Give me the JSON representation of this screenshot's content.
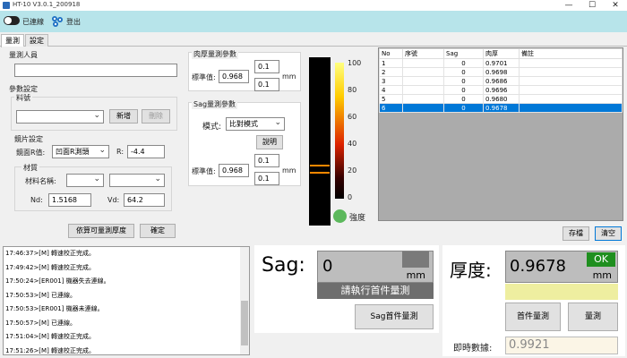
{
  "window": {
    "title": "HT-10 V3.0.1_200918",
    "minimize": "—",
    "maximize": "☐",
    "close": "✕"
  },
  "toolbar": {
    "connect_label": "已連線",
    "logout_label": "登出"
  },
  "tabs": [
    {
      "label": "量測"
    },
    {
      "label": "設定"
    }
  ],
  "left": {
    "operator_label": "量測人員",
    "operator_value": "",
    "params_label": "參數設定",
    "material_no_label": "料號",
    "material_no_value": "",
    "add_label": "新增",
    "delete_label": "刪除",
    "lens_label": "鏡片設定",
    "r_mode_label": "鏡面R值:",
    "r_mode_value": "凹面R測頭",
    "r_label": "R:",
    "r_value": "-4.4",
    "material_label": "材質",
    "material_name_label": "材料名稱:",
    "material_name_value": "",
    "material_name_value2": "",
    "nd_label": "Nd:",
    "nd_value": "1.5168",
    "vd_label": "Vd:",
    "vd_value": "64.2",
    "calc_label": "依算可量測厚度",
    "confirm_label": "確定"
  },
  "mid": {
    "thick_group_label": "肉厚量測參數",
    "std_label": "標準值:",
    "std_value": "0.968",
    "tol_plus": "0.1",
    "tol_minus": "0.1",
    "unit_mm": "mm",
    "sag_group_label": "Sag量測參數",
    "mode_label": "模式:",
    "mode_value": "比對模式",
    "explain_label": "說明",
    "sag_std_label": "標準值:",
    "sag_std_value": "0.968",
    "sag_tol_plus": "0.1",
    "sag_tol_minus": "0.1",
    "sag_unit": "mm"
  },
  "gauge": {
    "ticks": [
      "100",
      "80",
      "60",
      "40",
      "20",
      "0"
    ],
    "intensity_label": "強度",
    "colors": {
      "low": "#000000",
      "mid": "#cc2200",
      "high": "#ffff66",
      "indicator": "#ff8800",
      "lamp": "#5cb85c"
    }
  },
  "table": {
    "columns": [
      "No",
      "序號",
      "Sag",
      "肉厚",
      "備註"
    ],
    "rows": [
      {
        "no": "1",
        "serial": "",
        "sag": "0",
        "thick": "0.9701",
        "note": ""
      },
      {
        "no": "2",
        "serial": "",
        "sag": "0",
        "thick": "0.9698",
        "note": ""
      },
      {
        "no": "3",
        "serial": "",
        "sag": "0",
        "thick": "0.9686",
        "note": ""
      },
      {
        "no": "4",
        "serial": "",
        "sag": "0",
        "thick": "0.9696",
        "note": ""
      },
      {
        "no": "5",
        "serial": "",
        "sag": "0",
        "thick": "0.9680",
        "note": ""
      },
      {
        "no": "6",
        "serial": "",
        "sag": "0",
        "thick": "0.9678",
        "note": ""
      }
    ],
    "selected_index": 5,
    "save_label": "存檔",
    "clear_label": "清空"
  },
  "log": {
    "lines": [
      "17:46:37>[M] 轉速校正完成。",
      "17:49:42>[M] 轉速校正完成。",
      "17:50:24>[ER001] 機器失去連線。",
      "17:50:53>[M] 已連線。",
      "17:50:53>[ER001] 機器未連線。",
      "17:50:57>[M] 已連線。",
      "17:51:04>[M] 轉速校正完成。",
      "17:51:26>[M] 轉速校正完成。"
    ]
  },
  "sag_panel": {
    "label": "Sag:",
    "value": "0",
    "unit": "mm",
    "status": "請執行首件量測",
    "first_piece_label": "Sag首件量測"
  },
  "thick_panel": {
    "label": "厚度:",
    "value": "0.9678",
    "ok": "OK",
    "unit": "mm",
    "first_piece_label": "首件量測",
    "measure_label": "量測",
    "realtime_label": "即時數據:",
    "realtime_value": "0.9921",
    "ok_color": "#1f8f1f",
    "status_color": "#eeeea0"
  }
}
